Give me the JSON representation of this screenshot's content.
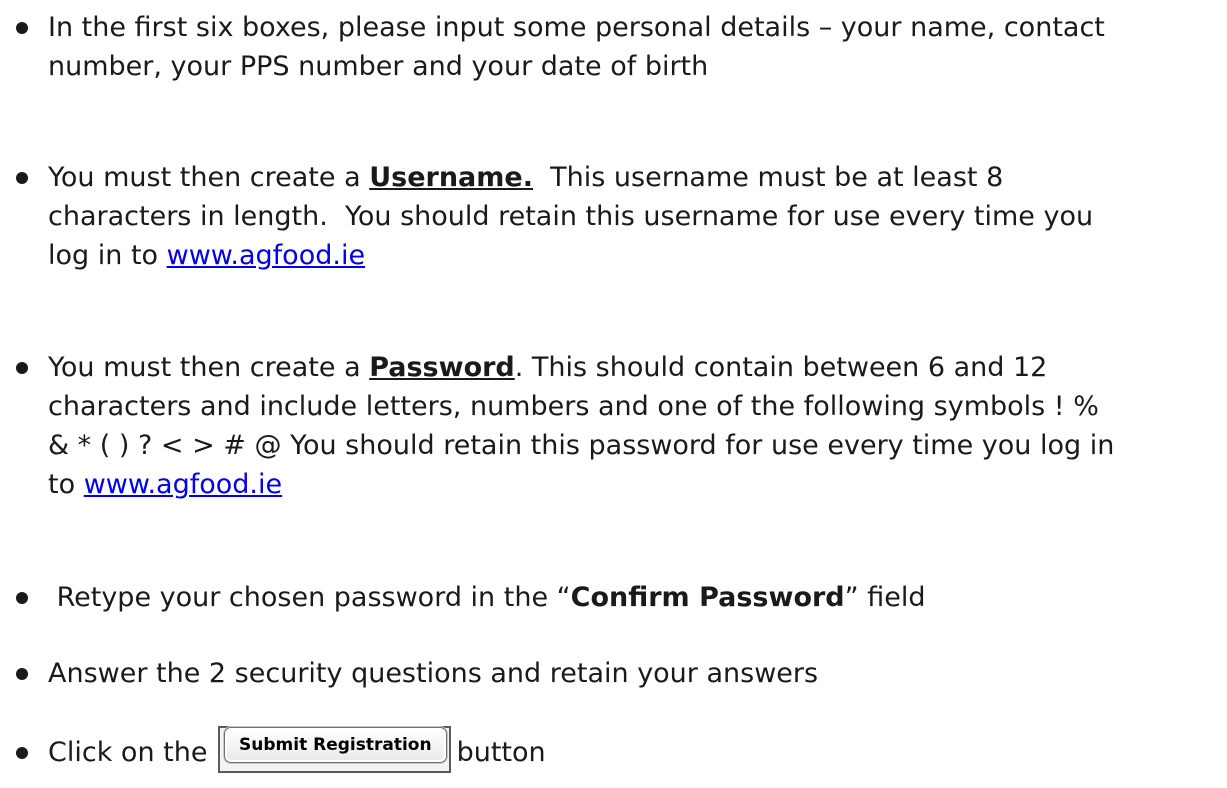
{
  "instructions": [
    {
      "lines": [
        "In the first six boxes, please input some personal details – your name, contact",
        "number, your PPS number and your date of birth"
      ]
    },
    {
      "line1_pre": "You must then create a ",
      "line1_emph": "Username.",
      "line1_post": "  This username must be at least 8",
      "line2": "characters in length.  You should retain this username for use every time you",
      "line3_pre": "log in to ",
      "link": "www.agfood.ie"
    },
    {
      "line1_pre": "You must then create a ",
      "line1_emph": "Password",
      "line1_post": ". This should contain between 6 and 12",
      "line2": "characters and include letters, numbers and one of the following symbols ! %",
      "line3": "& * ( ) ? < > # @ You should retain this password for use every time you log in",
      "line4_pre": "to ",
      "link": "www.agfood.ie"
    },
    {
      "pre": " Retype your chosen password in the “",
      "emph": "Confirm Password",
      "post": "” field"
    },
    {
      "text": "Answer the 2 security questions and retain your answers"
    },
    {
      "pre": "Click on the ",
      "button_label": "Submit Registration",
      "post": "button"
    }
  ]
}
